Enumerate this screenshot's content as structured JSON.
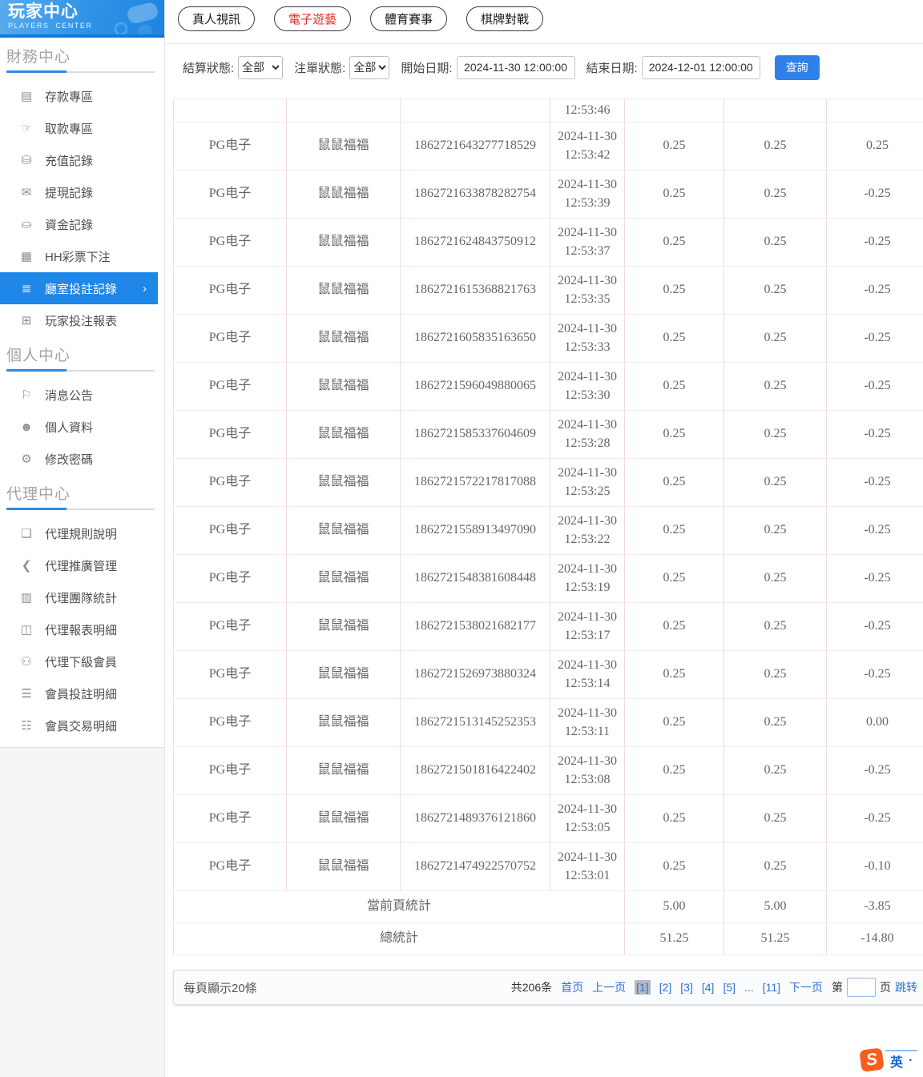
{
  "sidebar": {
    "title": "玩家中心",
    "subtitle": "PLAYERS CENTER",
    "sections": [
      {
        "title": "財務中心",
        "items": [
          {
            "name": "deposit-zone",
            "glyph": "▤",
            "label": "存款專區",
            "interactable": "true"
          },
          {
            "name": "withdraw-zone",
            "glyph": "☞",
            "label": "取款專區",
            "interactable": "true"
          },
          {
            "name": "recharge-records",
            "glyph": "⛁",
            "label": "充值記錄",
            "interactable": "true"
          },
          {
            "name": "withdrawal-records",
            "glyph": "✉",
            "label": "提現記錄",
            "interactable": "true"
          },
          {
            "name": "funds-records",
            "glyph": "⛀",
            "label": "資金記錄",
            "interactable": "true"
          },
          {
            "name": "hh-lottery-bets",
            "glyph": "▦",
            "label": "HH彩票下注",
            "interactable": "true"
          },
          {
            "name": "room-bet-records",
            "glyph": "≣",
            "label": "廳室投註記錄",
            "state": "active",
            "chevron": "›",
            "interactable": "true"
          },
          {
            "name": "player-bet-report",
            "glyph": "⊞",
            "label": "玩家投注報表",
            "interactable": "true"
          }
        ]
      },
      {
        "title": "個人中心",
        "items": [
          {
            "name": "announcements",
            "glyph": "⚐",
            "label": "消息公告",
            "interactable": "true"
          },
          {
            "name": "profile",
            "glyph": "☻",
            "label": "個人資料",
            "interactable": "true"
          },
          {
            "name": "change-password",
            "glyph": "⚙",
            "label": "修改密碼",
            "interactable": "true"
          }
        ]
      },
      {
        "title": "代理中心",
        "items": [
          {
            "name": "agent-rules",
            "glyph": "❏",
            "label": "代理規則說明",
            "interactable": "true"
          },
          {
            "name": "agent-promotion",
            "glyph": "❮",
            "label": "代理推廣管理",
            "interactable": "true"
          },
          {
            "name": "agent-team-stats",
            "glyph": "▥",
            "label": "代理團隊統計",
            "interactable": "true"
          },
          {
            "name": "agent-report-detail",
            "glyph": "◫",
            "label": "代理報表明細",
            "interactable": "true"
          },
          {
            "name": "agent-sub-members",
            "glyph": "⚇",
            "label": "代理下級會員",
            "interactable": "true"
          },
          {
            "name": "member-bet-detail",
            "glyph": "☰",
            "label": "會員投註明細",
            "interactable": "true"
          },
          {
            "name": "member-transaction-detail",
            "glyph": "☷",
            "label": "會員交易明細",
            "interactable": "true"
          }
        ]
      }
    ]
  },
  "tabs": [
    {
      "label": "真人視訊"
    },
    {
      "label": "電子遊藝",
      "state": "active"
    },
    {
      "label": "體育賽事"
    },
    {
      "label": "棋牌對戰"
    }
  ],
  "filters": {
    "settle_status_label": "結算狀態:",
    "settle_status_value": "全部",
    "order_status_label": "注單狀態:",
    "order_status_value": "全部",
    "start_date_label": "開始日期:",
    "start_date_value": "2024-11-30 12:00:00",
    "end_date_label": "結束日期:",
    "end_date_value": "2024-12-01 12:00:00",
    "query_label": "查詢"
  },
  "table": {
    "partial_row_time": "12:53:46",
    "rows": [
      {
        "provider": "PG电子",
        "game": "鼠鼠福福",
        "bet_id": "1862721643277718529",
        "date": "2024-11-30",
        "time": "12:53:42",
        "bet": "0.25",
        "valid": "0.25",
        "payout": "0.25"
      },
      {
        "provider": "PG电子",
        "game": "鼠鼠福福",
        "bet_id": "1862721633878282754",
        "date": "2024-11-30",
        "time": "12:53:39",
        "bet": "0.25",
        "valid": "0.25",
        "payout": "-0.25"
      },
      {
        "provider": "PG电子",
        "game": "鼠鼠福福",
        "bet_id": "1862721624843750912",
        "date": "2024-11-30",
        "time": "12:53:37",
        "bet": "0.25",
        "valid": "0.25",
        "payout": "-0.25"
      },
      {
        "provider": "PG电子",
        "game": "鼠鼠福福",
        "bet_id": "1862721615368821763",
        "date": "2024-11-30",
        "time": "12:53:35",
        "bet": "0.25",
        "valid": "0.25",
        "payout": "-0.25"
      },
      {
        "provider": "PG电子",
        "game": "鼠鼠福福",
        "bet_id": "1862721605835163650",
        "date": "2024-11-30",
        "time": "12:53:33",
        "bet": "0.25",
        "valid": "0.25",
        "payout": "-0.25"
      },
      {
        "provider": "PG电子",
        "game": "鼠鼠福福",
        "bet_id": "1862721596049880065",
        "date": "2024-11-30",
        "time": "12:53:30",
        "bet": "0.25",
        "valid": "0.25",
        "payout": "-0.25"
      },
      {
        "provider": "PG电子",
        "game": "鼠鼠福福",
        "bet_id": "1862721585337604609",
        "date": "2024-11-30",
        "time": "12:53:28",
        "bet": "0.25",
        "valid": "0.25",
        "payout": "-0.25"
      },
      {
        "provider": "PG电子",
        "game": "鼠鼠福福",
        "bet_id": "1862721572217817088",
        "date": "2024-11-30",
        "time": "12:53:25",
        "bet": "0.25",
        "valid": "0.25",
        "payout": "-0.25"
      },
      {
        "provider": "PG电子",
        "game": "鼠鼠福福",
        "bet_id": "1862721558913497090",
        "date": "2024-11-30",
        "time": "12:53:22",
        "bet": "0.25",
        "valid": "0.25",
        "payout": "-0.25"
      },
      {
        "provider": "PG电子",
        "game": "鼠鼠福福",
        "bet_id": "1862721548381608448",
        "date": "2024-11-30",
        "time": "12:53:19",
        "bet": "0.25",
        "valid": "0.25",
        "payout": "-0.25"
      },
      {
        "provider": "PG电子",
        "game": "鼠鼠福福",
        "bet_id": "1862721538021682177",
        "date": "2024-11-30",
        "time": "12:53:17",
        "bet": "0.25",
        "valid": "0.25",
        "payout": "-0.25"
      },
      {
        "provider": "PG电子",
        "game": "鼠鼠福福",
        "bet_id": "1862721526973880324",
        "date": "2024-11-30",
        "time": "12:53:14",
        "bet": "0.25",
        "valid": "0.25",
        "payout": "-0.25"
      },
      {
        "provider": "PG电子",
        "game": "鼠鼠福福",
        "bet_id": "1862721513145252353",
        "date": "2024-11-30",
        "time": "12:53:11",
        "bet": "0.25",
        "valid": "0.25",
        "payout": "0.00"
      },
      {
        "provider": "PG电子",
        "game": "鼠鼠福福",
        "bet_id": "1862721501816422402",
        "date": "2024-11-30",
        "time": "12:53:08",
        "bet": "0.25",
        "valid": "0.25",
        "payout": "-0.25"
      },
      {
        "provider": "PG电子",
        "game": "鼠鼠福福",
        "bet_id": "1862721489376121860",
        "date": "2024-11-30",
        "time": "12:53:05",
        "bet": "0.25",
        "valid": "0.25",
        "payout": "-0.25"
      },
      {
        "provider": "PG电子",
        "game": "鼠鼠福福",
        "bet_id": "1862721474922570752",
        "date": "2024-11-30",
        "time": "12:53:01",
        "bet": "0.25",
        "valid": "0.25",
        "payout": "-0.10"
      }
    ],
    "page_summary": {
      "label": "當前頁統計",
      "bet": "5.00",
      "valid": "5.00",
      "payout": "-3.85"
    },
    "total_summary": {
      "label": "總統計",
      "bet": "51.25",
      "valid": "51.25",
      "payout": "-14.80"
    }
  },
  "pagination": {
    "page_size_text": "每頁顯示20條",
    "total_text": "共206条",
    "items": [
      {
        "text": "首页",
        "type": "link",
        "interactable": "true"
      },
      {
        "text": "上一页",
        "type": "link",
        "interactable": "true"
      },
      {
        "text": "[1]",
        "type": "current",
        "interactable": "true"
      },
      {
        "text": "[2]",
        "type": "link",
        "interactable": "true"
      },
      {
        "text": "[3]",
        "type": "link",
        "interactable": "true"
      },
      {
        "text": "[4]",
        "type": "link",
        "interactable": "true"
      },
      {
        "text": "[5]",
        "type": "link",
        "interactable": "true"
      },
      {
        "text": "...",
        "type": "plain",
        "interactable": "false"
      },
      {
        "text": "[11]",
        "type": "link",
        "interactable": "true"
      },
      {
        "text": "下一页",
        "type": "link",
        "interactable": "true"
      }
    ],
    "jump_prefix": "第",
    "jump_suffix": "页",
    "jump_action": "跳转"
  },
  "ime": {
    "logo_letter": "S",
    "mode": "英",
    "dot": "·"
  },
  "colors": {
    "sidebar_active_blue": "#1e87e8",
    "header_gradient_blue": "#2f92e6",
    "tab_active_red": "#e8302a",
    "link_blue": "#2a72d9",
    "query_button_blue": "#2f80e9",
    "table_vertical_border_pink": "#f3dcdc",
    "table_horizontal_border_gray": "#ededed",
    "ime_orange": "#f85d1d"
  }
}
